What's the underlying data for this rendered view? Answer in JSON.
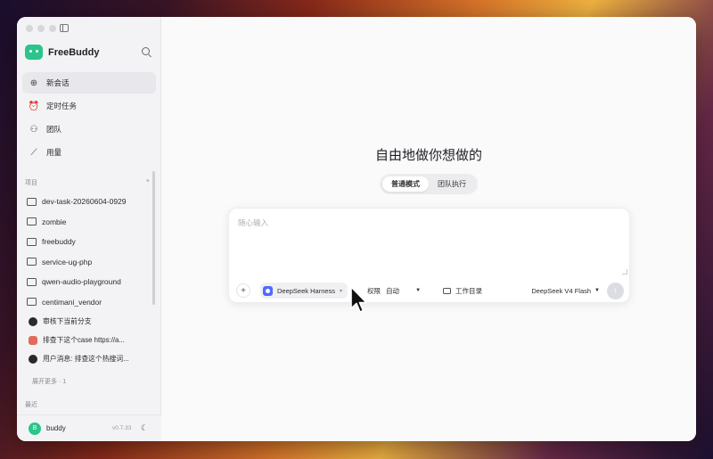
{
  "app": {
    "name": "FreeBuddy"
  },
  "sidebar": {
    "nav": [
      {
        "label": "新会话",
        "icon": "new-chat-icon",
        "active": true
      },
      {
        "label": "定时任务",
        "icon": "alarm-clock-icon",
        "active": false
      },
      {
        "label": "团队",
        "icon": "users-icon",
        "active": false
      },
      {
        "label": "用量",
        "icon": "chart-icon",
        "active": false
      }
    ],
    "projects_label": "项目",
    "projects": [
      "dev-task-20260604-0929",
      "zombie",
      "freebuddy",
      "service-ug-php",
      "qwen-audio-playground",
      "centimani_vendor"
    ],
    "chats": [
      {
        "label": "审核下当前分支",
        "icon": "dark"
      },
      {
        "label": "排查下这个case https://a...",
        "icon": "red"
      },
      {
        "label": "用户消息: 排查这个热搜词...",
        "icon": "dark"
      }
    ],
    "expand_more": "展开更多 · 1",
    "recent_label": "最近",
    "user": {
      "initial": "B",
      "name": "buddy",
      "version": "v0.7.33"
    }
  },
  "main": {
    "headline": "自由地做你想做的",
    "modes": [
      "普通模式",
      "团队执行"
    ],
    "composer": {
      "placeholder": "随心输入",
      "harness": "DeepSeek Harness",
      "permission_label": "权限",
      "permission_value": "自动",
      "workdir": "工作目录",
      "model": "DeepSeek V4 Flash"
    }
  }
}
